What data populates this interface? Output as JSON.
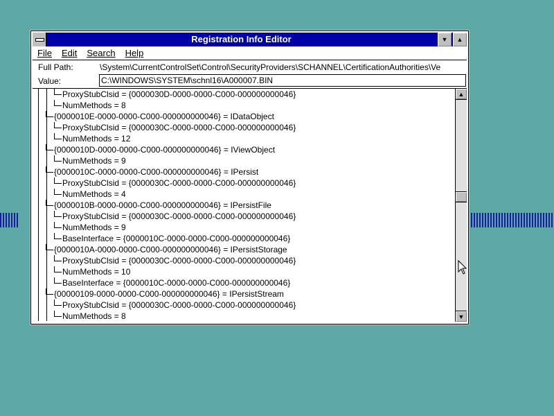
{
  "window": {
    "title": "Registration Info Editor"
  },
  "menu": [
    "File",
    "Edit",
    "Search",
    "Help"
  ],
  "fields": {
    "full_path_label": "Full Path:",
    "full_path_value": "\\System\\CurrentControlSet\\Control\\SecurityProviders\\SCHANNEL\\CertificationAuthorities\\Ve",
    "value_label": "Value:",
    "value_text": "C:\\WINDOWS\\SYSTEM\\schnl16\\A000007.BIN"
  },
  "tree": [
    {
      "level": 2,
      "text": "ProxyStubClsid = {0000030D-0000-0000-C000-000000000046}"
    },
    {
      "level": 2,
      "text": "NumMethods = 8"
    },
    {
      "level": 1,
      "text": "{0000010E-0000-0000-C000-000000000046} = IDataObject"
    },
    {
      "level": 2,
      "text": "ProxyStubClsid = {0000030C-0000-0000-C000-000000000046}"
    },
    {
      "level": 2,
      "text": "NumMethods = 12"
    },
    {
      "level": 1,
      "text": "{0000010D-0000-0000-C000-000000000046} = IViewObject"
    },
    {
      "level": 2,
      "text": "NumMethods = 9"
    },
    {
      "level": 1,
      "text": "{0000010C-0000-0000-C000-000000000046} = IPersist"
    },
    {
      "level": 2,
      "text": "ProxyStubClsid = {0000030C-0000-0000-C000-000000000046}"
    },
    {
      "level": 2,
      "text": "NumMethods = 4"
    },
    {
      "level": 1,
      "text": "{0000010B-0000-0000-C000-000000000046} = IPersistFile"
    },
    {
      "level": 2,
      "text": "ProxyStubClsid = {0000030C-0000-0000-C000-000000000046}"
    },
    {
      "level": 2,
      "text": "NumMethods = 9"
    },
    {
      "level": 2,
      "text": "BaseInterface = {0000010C-0000-0000-C000-000000000046}"
    },
    {
      "level": 1,
      "text": "{0000010A-0000-0000-C000-000000000046} = IPersistStorage"
    },
    {
      "level": 2,
      "text": "ProxyStubClsid = {0000030C-0000-0000-C000-000000000046}"
    },
    {
      "level": 2,
      "text": "NumMethods = 10"
    },
    {
      "level": 2,
      "text": "BaseInterface = {0000010C-0000-0000-C000-000000000046}"
    },
    {
      "level": 1,
      "text": "{00000109-0000-0000-C000-000000000046} = IPersistStream"
    },
    {
      "level": 2,
      "text": "ProxyStubClsid = {0000030C-0000-0000-C000-000000000046}"
    },
    {
      "level": 2,
      "text": "NumMethods = 8"
    }
  ],
  "scrollbar": {
    "position": 0.46
  },
  "colors": {
    "desktop": "#5fa8a8",
    "titlebar": "#0000a8",
    "stripes": "#1a1aa8"
  }
}
